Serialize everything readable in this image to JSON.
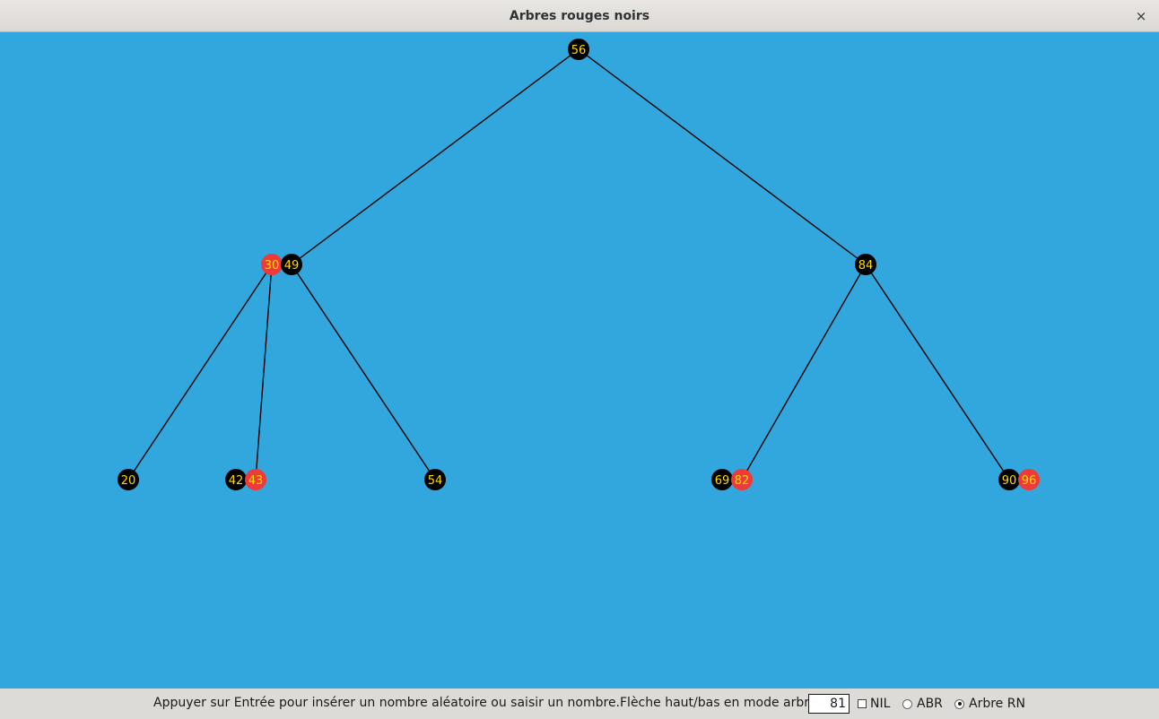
{
  "window": {
    "title": "Arbres rouges noirs",
    "close_symbol": "×"
  },
  "colors": {
    "background": "#31a7dd",
    "node_black": "#000000",
    "node_red": "#ee3a3a",
    "node_text": "#ffd800",
    "edge": "#000000"
  },
  "tree": {
    "nodes": [
      {
        "id": "n56",
        "parts": [
          {
            "key": "56",
            "color": "black"
          }
        ],
        "parent": null
      },
      {
        "id": "n30-49",
        "parts": [
          {
            "key": "30",
            "color": "red"
          },
          {
            "key": "49",
            "color": "black"
          }
        ],
        "parent": "n56"
      },
      {
        "id": "n84",
        "parts": [
          {
            "key": "84",
            "color": "black"
          }
        ],
        "parent": "n56"
      },
      {
        "id": "n20",
        "parts": [
          {
            "key": "20",
            "color": "black"
          }
        ],
        "parent": "n30-49"
      },
      {
        "id": "n42-43",
        "parts": [
          {
            "key": "42",
            "color": "black"
          },
          {
            "key": "43",
            "color": "red"
          }
        ],
        "parent": "n30-49"
      },
      {
        "id": "n54",
        "parts": [
          {
            "key": "54",
            "color": "black"
          }
        ],
        "parent": "n30-49"
      },
      {
        "id": "n69-82",
        "parts": [
          {
            "key": "69",
            "color": "black"
          },
          {
            "key": "82",
            "color": "red"
          }
        ],
        "parent": "n84"
      },
      {
        "id": "n90-96",
        "parts": [
          {
            "key": "90",
            "color": "black"
          },
          {
            "key": "96",
            "color": "red"
          }
        ],
        "parent": "n84"
      }
    ]
  },
  "statusbar": {
    "hint": "Appuyer sur Entrée pour insérer un nombre aléatoire ou saisir un nombre.Flèche haut/bas en mode arbre RN.",
    "input_value": "81",
    "nil_label": "NIL",
    "nil_checked": false,
    "abr_label": "ABR",
    "rn_label": "Arbre RN",
    "selected_mode": "Arbre RN"
  }
}
